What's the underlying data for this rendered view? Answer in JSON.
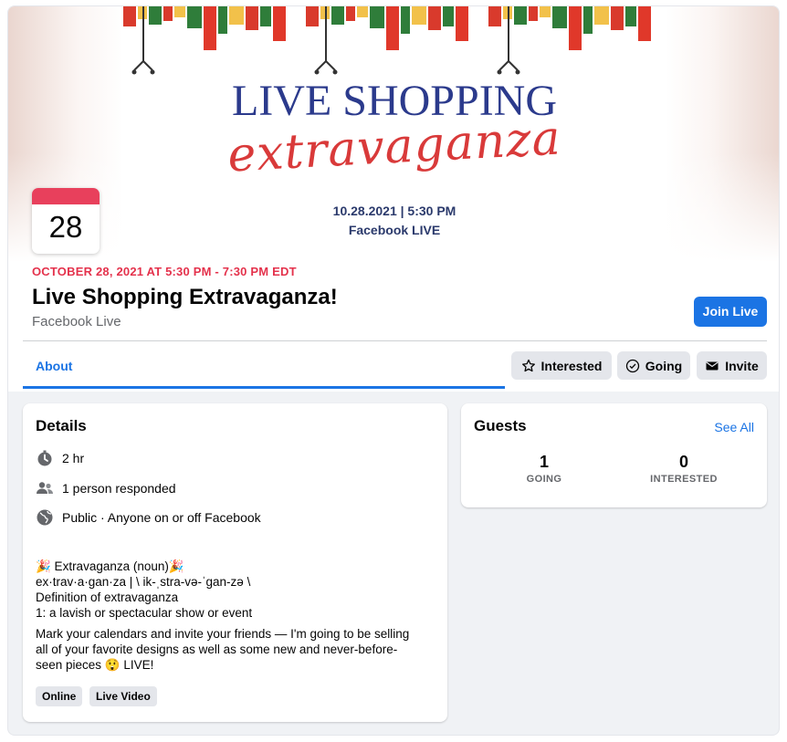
{
  "cover": {
    "title_line1": "LIVE SHOPPING",
    "title_line2": "extravaganza",
    "date_time": "10.28.2021 | 5:30 PM",
    "location": "Facebook LIVE"
  },
  "calendar": {
    "day": "28",
    "accent_color": "#e8405c"
  },
  "event": {
    "date_line": "OCTOBER 28, 2021 AT 5:30 PM - 7:30 PM EDT",
    "title": "Live Shopping Extravaganza!",
    "host": "Facebook Live",
    "join_label": "Join Live"
  },
  "tabs": {
    "about": "About"
  },
  "actions": {
    "interested": {
      "label": "Interested",
      "icon": "star-icon"
    },
    "going": {
      "label": "Going",
      "icon": "check-circle-icon"
    },
    "invite": {
      "label": "Invite",
      "icon": "envelope-icon"
    }
  },
  "details": {
    "heading": "Details",
    "rows": [
      {
        "icon": "stopwatch-icon",
        "text": "2 hr"
      },
      {
        "icon": "people-icon",
        "text": "1 person responded"
      },
      {
        "icon": "globe-icon",
        "text": "Public · Anyone on or off Facebook"
      }
    ],
    "description": {
      "line1": "🎉 Extravaganza (noun)🎉",
      "line2": "ex·trav·a·gan·za | \\ ik-ˌstra-və-ˈgan-zə \\",
      "line3": "Definition of extravaganza",
      "line4": "1: a lavish or spectacular show or event",
      "para_line1": "Mark your calendars and invite your friends — I'm going to be selling",
      "para_line2": "all of your favorite designs as well as some new and never-before-",
      "para_line3": "seen pieces 😲 LIVE!"
    },
    "tags": [
      "Online",
      "Live Video"
    ]
  },
  "guests": {
    "heading": "Guests",
    "see_all": "See All",
    "going": {
      "count": "1",
      "label": "GOING"
    },
    "interested": {
      "count": "0",
      "label": "INTERESTED"
    }
  },
  "colors": {
    "primary": "#1b74e4",
    "date_red": "#e4324c",
    "cover_blue": "#2b3a8c",
    "cover_red": "#d93a3a"
  }
}
